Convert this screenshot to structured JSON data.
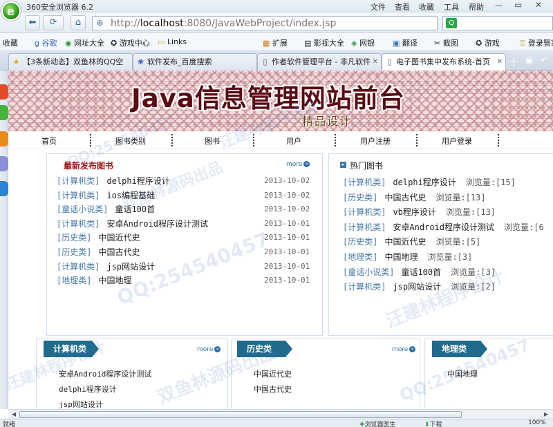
{
  "browser": {
    "title": "360安全浏览器 6.2",
    "menu": [
      "文件",
      "查看",
      "收藏",
      "工具",
      "帮助"
    ],
    "address": {
      "prefix": "http://",
      "host": "localhost",
      "rest": ":8080/JavaWebProject/index.jsp"
    },
    "favorites": [
      "收藏",
      "谷歌",
      "网址大全",
      "游戏中心",
      "Links",
      "扩展",
      "影视大全",
      "网银",
      "翻译",
      "截图",
      "游戏",
      "登录管家"
    ],
    "tabs": [
      {
        "label": "【3条新动态】双鱼林的QQ空",
        "icon": "star-icon"
      },
      {
        "label": "软件发布_百度搜索",
        "icon": "paw-icon"
      },
      {
        "label": "作者软件管理平台 - 非凡软件",
        "icon": "page-icon"
      },
      {
        "label": "电子图书集中发布系统-首页",
        "icon": "page-icon"
      }
    ],
    "status": {
      "left": "就绪",
      "browser_doctor": "浏览器医生",
      "download": "下载",
      "zoom": "100%"
    }
  },
  "site": {
    "banner_title": "Java信息管理网站前台",
    "banner_subtitle": "精品设计",
    "nav": [
      "首页",
      "图书类别",
      "图书",
      "用户",
      "用户注册",
      "用户登录"
    ],
    "latest": {
      "title": "最新发布图书",
      "more": "more",
      "items": [
        {
          "cat": "[计算机类]",
          "title": "delphi程序设计",
          "date": "2013-10-02"
        },
        {
          "cat": "[计算机类]",
          "title": "ios编程基础",
          "date": "2013-10-02"
        },
        {
          "cat": "[童话小说类]",
          "title": "童话100首",
          "date": "2013-10-02"
        },
        {
          "cat": "[计算机类]",
          "title": "安卓Android程序设计测试",
          "date": "2013-10-01"
        },
        {
          "cat": "[历史类]",
          "title": "中国近代史",
          "date": "2013-10-01"
        },
        {
          "cat": "[历史类]",
          "title": "中国古代史",
          "date": "2013-10-01"
        },
        {
          "cat": "[计算机类]",
          "title": "jsp网站设计",
          "date": "2013-10-01"
        },
        {
          "cat": "[地理类]",
          "title": "中国地理",
          "date": "2013-10-01"
        }
      ]
    },
    "hot": {
      "title": "热门图书",
      "items": [
        {
          "cat": "[计算机类]",
          "title": "delphi程序设计",
          "views": "浏览量:[15]"
        },
        {
          "cat": "[历史类]",
          "title": "中国古代史",
          "views": "浏览量:[13]"
        },
        {
          "cat": "[计算机类]",
          "title": "vb程序设计",
          "views": "浏览量:[13]"
        },
        {
          "cat": "[计算机类]",
          "title": "安卓Android程序设计测试",
          "views": "浏览量:[6"
        },
        {
          "cat": "[历史类]",
          "title": "中国近代史",
          "views": "浏览量:[5]"
        },
        {
          "cat": "[地理类]",
          "title": "中国地理",
          "views": "浏览量:[3]"
        },
        {
          "cat": "[童话小说类]",
          "title": "童话100首",
          "views": "浏览量:[3]"
        },
        {
          "cat": "[计算机类]",
          "title": "jsp网站设计",
          "views": "浏览量:[2]"
        }
      ]
    },
    "categories": [
      {
        "name": "计算机类",
        "more": "more",
        "items": [
          "安卓Android程序设计测试",
          "delphi程序设计",
          "jsp网站设计"
        ]
      },
      {
        "name": "历史类",
        "more": "more",
        "items": [
          "中国近代史",
          "中国古代史"
        ]
      },
      {
        "name": "地理类",
        "items": [
          "中国地理"
        ]
      }
    ]
  },
  "watermarks": {
    "qq": "QQ:254540457",
    "maker": "双鱼林源码出品",
    "program": "汪建林程序设计"
  },
  "colors": {
    "accent": "#1e6b8e",
    "latest_title": "#a30f0f",
    "category_text": "#4a78a8"
  }
}
